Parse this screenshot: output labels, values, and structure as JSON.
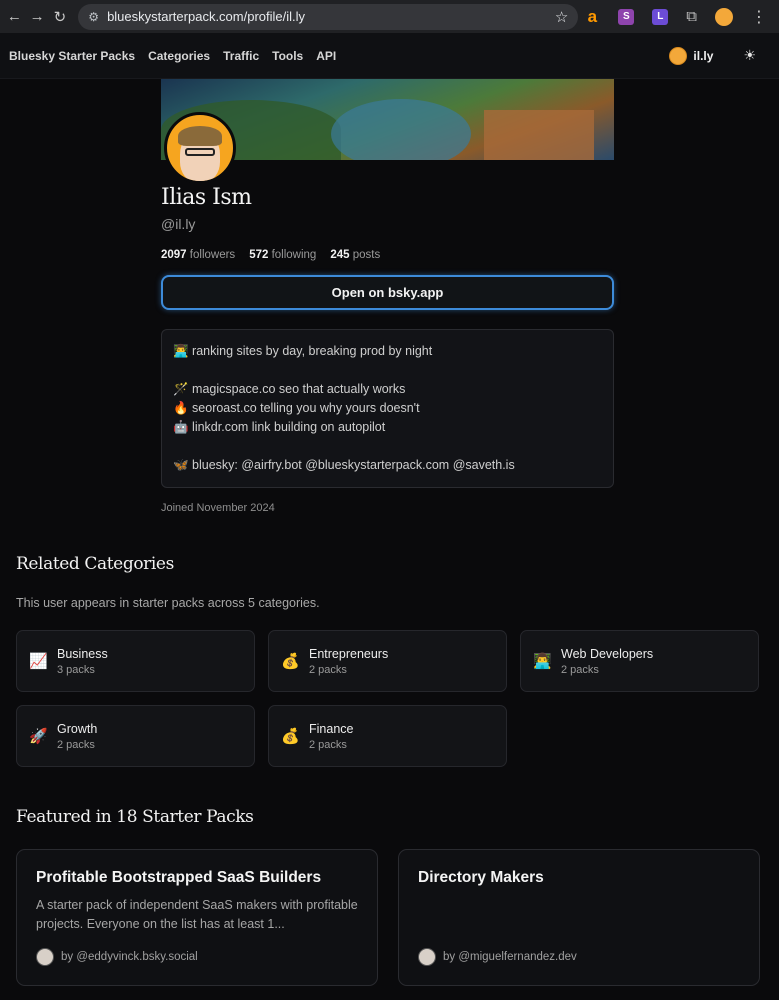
{
  "browser": {
    "url": "blueskystarterpack.com/profile/il.ly",
    "extensions": [
      "a",
      "S",
      "L"
    ]
  },
  "nav": {
    "brand": "Bluesky Starter Packs",
    "links": [
      "Categories",
      "Traffic",
      "Tools",
      "API"
    ],
    "user_handle": "il.ly"
  },
  "profile": {
    "name": "Ilias Ism",
    "handle": "@il.ly",
    "followers_count": "2097",
    "followers_label": "followers",
    "following_count": "572",
    "following_label": "following",
    "posts_count": "245",
    "posts_label": "posts",
    "open_button": "Open on bsky.app",
    "bio": {
      "line1": "👨‍💻 ranking sites by day, breaking prod by night",
      "line2": "🪄 magicspace.co seo that actually works",
      "line3": "🔥 seoroast.co telling you why yours doesn't",
      "line4": "🤖 linkdr.com link building on autopilot",
      "line5": "🦋 bluesky: @airfry.bot @blueskystarterpack.com @saveth.is"
    },
    "joined": "Joined November 2024"
  },
  "related": {
    "title": "Related Categories",
    "subtitle": "This user appears in starter packs across 5 categories.",
    "categories": [
      {
        "emoji": "📈",
        "name": "Business",
        "count": "3 packs"
      },
      {
        "emoji": "💰",
        "name": "Entrepreneurs",
        "count": "2 packs"
      },
      {
        "emoji": "👨‍💻",
        "name": "Web Developers",
        "count": "2 packs"
      },
      {
        "emoji": "🚀",
        "name": "Growth",
        "count": "2 packs"
      },
      {
        "emoji": "💰",
        "name": "Finance",
        "count": "2 packs"
      }
    ]
  },
  "featured": {
    "title": "Featured in 18 Starter Packs",
    "packs": [
      {
        "title": "Profitable Bootstrapped SaaS Builders",
        "description": "A starter pack of independent SaaS makers with profitable projects. Everyone on the list has at least 1...",
        "by": "by @eddyvinck.bsky.social"
      },
      {
        "title": "Directory Makers",
        "description": "",
        "by": "by @miguelfernandez.dev"
      }
    ]
  }
}
